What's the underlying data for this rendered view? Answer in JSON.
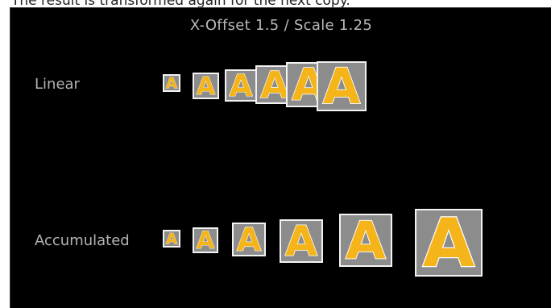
{
  "caption": "The result is transformed again for the next copy.",
  "title": "X-Offset 1.5 / Scale 1.25",
  "rows": {
    "linear": {
      "label": "Linear",
      "count": 6
    },
    "accumulated": {
      "label": "Accumulated",
      "count": 6
    }
  },
  "tile_glyph": "A",
  "tile_glyph_icon": "letter-a-icon",
  "colors": {
    "panel_background": "#000000",
    "tile_background": "#8c8c8c",
    "tile_border": "#f2f2f2",
    "glyph_fill": "#f4b41a",
    "glyph_stroke": "#ffffff",
    "text": "#b9b9b9"
  }
}
